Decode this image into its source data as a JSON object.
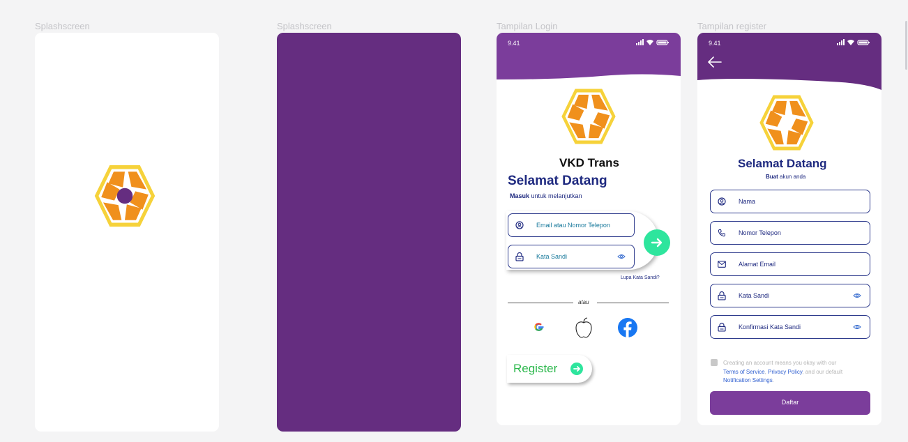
{
  "frames": {
    "splash1": {
      "label": "Splashscreen"
    },
    "splash2": {
      "label": "Splashscreen"
    },
    "login": {
      "label": "Tampilan Login"
    },
    "register": {
      "label": "Tampilan register"
    }
  },
  "status": {
    "time": "9.41"
  },
  "login": {
    "brand": "VKD Trans",
    "welcome": "Selamat Datang",
    "subtitle_bold": "Masuk",
    "subtitle_rest": " untuk melanjutkan",
    "email_placeholder": "Email atau Nomor Telepon",
    "password_placeholder": "Kata Sandi",
    "forgot": "Lupa Kata Sandi?",
    "divider": "atau",
    "register_label": "Register"
  },
  "register": {
    "welcome": "Selamat Datang",
    "subtitle_bold": "Buat",
    "subtitle_rest": " akun anda",
    "fields": {
      "name": "Nama",
      "phone": "Nomor Telepon",
      "email": "Alamat Email",
      "password": "Kata Sandi",
      "confirm": "Konfirmasi Kata Sandi"
    },
    "terms_line1": "Creating an account means you okay with our",
    "terms_link1": "Terms  of Service",
    "terms_sep": ", ",
    "terms_link2": "Privacy Policy",
    "terms_line2_rest": ", and our default",
    "terms_link3": "Notification Settings",
    "terms_end": ".",
    "submit": "Daftar"
  },
  "colors": {
    "purple_dark": "#652d80",
    "purple_header": "#7b3d9b",
    "navy": "#1f2a80",
    "orange": "#f0901c",
    "yellow": "#f6d23a",
    "green": "#2ee59d"
  }
}
